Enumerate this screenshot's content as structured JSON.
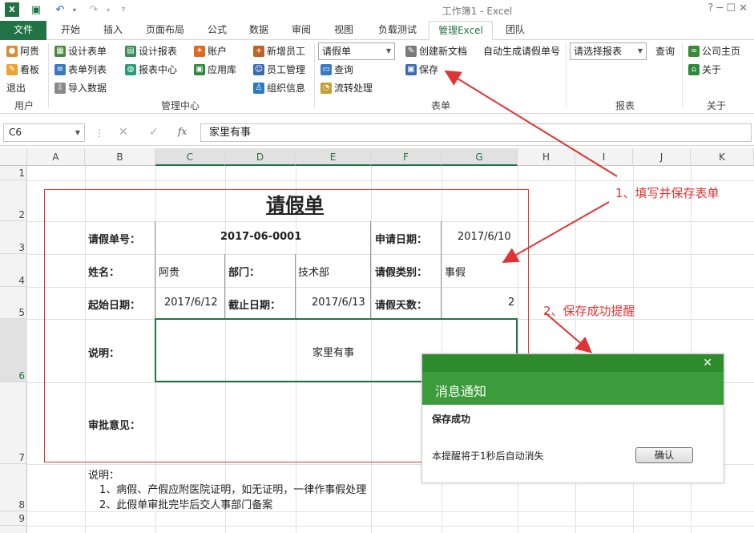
{
  "window": {
    "title": "工作簿1 - Excel",
    "controls": "?   ─   ☐   ✕"
  },
  "tabs": [
    "文件",
    "开始",
    "插入",
    "页面布局",
    "公式",
    "数据",
    "审阅",
    "视图",
    "负载测试",
    "管理Excel",
    "团队"
  ],
  "ribbon": {
    "user": {
      "items": [
        "阿贵",
        "看板",
        "退出"
      ],
      "group": "用户"
    },
    "manage": {
      "items": [
        "设计表单",
        "表单列表",
        "导入数据",
        "设计报表",
        "报表中心",
        "账户",
        "应用库",
        "新增员工",
        "员工管理",
        "组织信息"
      ],
      "group": "管理中心"
    },
    "form": {
      "select_value": "请假单",
      "items": [
        "查询",
        "流转处理",
        "创建新文档",
        "保存",
        "自动生成请假单号"
      ],
      "group": "表单"
    },
    "report": {
      "select_value": "请选择报表",
      "query": "查询",
      "group": "报表"
    },
    "about": {
      "items": [
        "公司主页",
        "关于"
      ],
      "group": "关于"
    }
  },
  "formula_bar": {
    "name_box": "C6",
    "fx": "fx",
    "value": "家里有事"
  },
  "columns": [
    "A",
    "B",
    "C",
    "D",
    "E",
    "F",
    "G",
    "H",
    "I",
    "J",
    "K"
  ],
  "rows": [
    "1",
    "2",
    "3",
    "4",
    "5",
    "6",
    "7",
    "8",
    "9"
  ],
  "sheet": {
    "title": "请假单",
    "no_label": "请假单号：",
    "no_value": "2017-06-0001",
    "apply_date_label": "申请日期：",
    "apply_date_value": "2017/6/10",
    "name_label": "姓名：",
    "name_value": "阿贵",
    "dept_label": "部门：",
    "dept_value": "技术部",
    "type_label": "请假类别：",
    "type_value": "事假",
    "start_label": "起始日期：",
    "start_value": "2017/6/12",
    "end_label": "截止日期：",
    "end_value": "2017/6/13",
    "days_label": "请假天数：",
    "days_value": "2",
    "desc_label": "说明：",
    "desc_value": "家里有事",
    "approval_label": "审批意见：",
    "notes_title": "说明：",
    "note1": "1、病假、产假应附医院证明，如无证明，一律作事假处理",
    "note2": "2、此假单审批完毕后交人事部门备案"
  },
  "toast": {
    "title": "消息通知",
    "close": "✕",
    "message": "保存成功",
    "sub": "本提醒将于1秒后自动消失",
    "ok": "确认"
  },
  "annotations": {
    "a1": "1、填写并保存表单",
    "a2": "2、保存成功提醒"
  },
  "colors": {
    "excel_green": "#217346",
    "annotation_red": "#e03333",
    "toast_green": "#3c9c3c"
  }
}
